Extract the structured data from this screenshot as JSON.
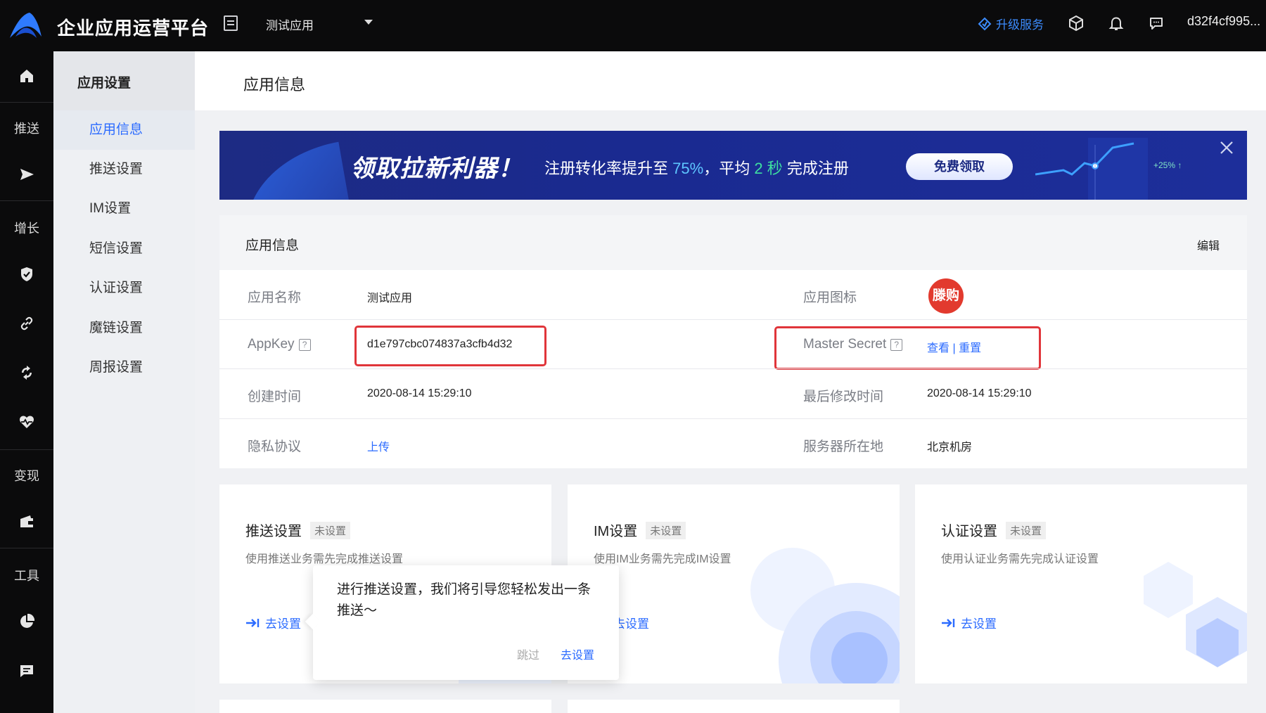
{
  "topbar": {
    "title": "企业应用运营平台",
    "app_selector": "测试应用",
    "upgrade": "升级服务",
    "user": "d32f4cf995..."
  },
  "leftnav": {
    "sections": [
      "推送",
      "增长",
      "变现",
      "工具"
    ]
  },
  "submenu": {
    "title": "应用设置",
    "items": [
      "应用信息",
      "推送设置",
      "IM设置",
      "短信设置",
      "认证设置",
      "魔链设置",
      "周报设置"
    ]
  },
  "page": {
    "title": "应用信息"
  },
  "banner": {
    "headline": "领取拉新利器！",
    "sub_prefix": "注册转化率提升至",
    "sub_rate": "75%",
    "sub_mid": "，平均",
    "sub_secs": "2 秒",
    "sub_suffix": "完成注册",
    "button": "免费领取",
    "chart_label": "+25% ↑"
  },
  "info": {
    "title": "应用信息",
    "edit": "编辑",
    "app_name_label": "应用名称",
    "app_name": "测试应用",
    "app_icon_label": "应用图标",
    "app_icon_text": "滕购",
    "appkey_label": "AppKey",
    "appkey": "d1e797cbc074837a3cfb4d32",
    "master_label": "Master Secret",
    "master_view": "查看",
    "master_sep": "|",
    "master_reset": "重置",
    "created_label": "创建时间",
    "created": "2020-08-14 15:29:10",
    "modified_label": "最后修改时间",
    "modified": "2020-08-14 15:29:10",
    "privacy_label": "隐私协议",
    "privacy_action": "上传",
    "server_label": "服务器所在地",
    "server": "北京机房"
  },
  "cards": [
    {
      "title": "推送设置",
      "tag": "未设置",
      "desc": "使用推送业务需先完成推送设置",
      "link": "去设置"
    },
    {
      "title": "IM设置",
      "tag": "未设置",
      "desc": "使用IM业务需先完成IM设置",
      "link": "去设置"
    },
    {
      "title": "认证设置",
      "tag": "未设置",
      "desc": "使用认证业务需先完成认证设置",
      "link": "去设置"
    }
  ],
  "popover": {
    "text": "进行推送设置，我们将引导您轻松发出一条推送～",
    "skip": "跳过",
    "go": "去设置"
  }
}
